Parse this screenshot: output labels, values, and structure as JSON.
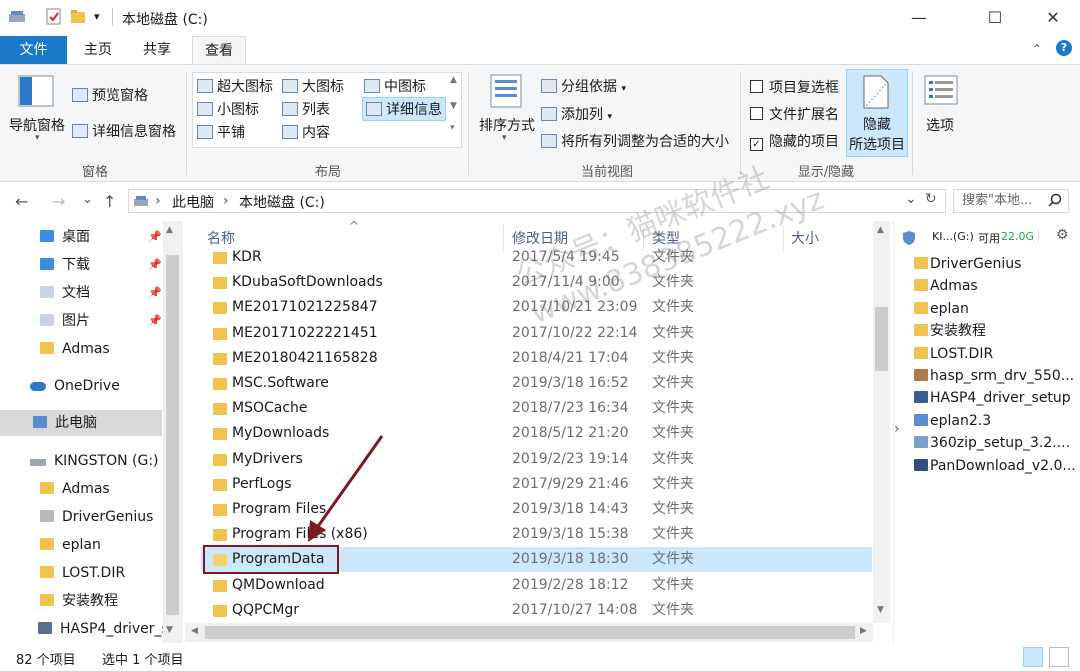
{
  "window": {
    "title": "本地磁盘 (C:)",
    "minimize": "—",
    "maximize": "☐",
    "close": "✕",
    "quick_access_dropdown": "▾"
  },
  "ribbon_tabs": {
    "file": "文件",
    "home": "主页",
    "share": "共享",
    "view": "查看"
  },
  "ribbon": {
    "panes": {
      "nav_pane": "导航窗格",
      "preview_pane": "预览窗格",
      "details_pane": "详细信息窗格",
      "group": "窗格"
    },
    "layout": {
      "xl_icons": "超大图标",
      "large_icons": "大图标",
      "medium_icons": "中图标",
      "small_icons": "小图标",
      "list": "列表",
      "details": "详细信息",
      "tiles": "平铺",
      "content": "内容",
      "group": "布局"
    },
    "current_view": {
      "sort_by": "排序方式",
      "group_by": "分组依据",
      "add_column": "添加列",
      "fit_columns": "将所有列调整为合适的大小",
      "group": "当前视图"
    },
    "show_hide": {
      "item_checkboxes": "项目复选框",
      "file_extensions": "文件扩展名",
      "hidden_items": "隐藏的项目",
      "hide_selected_line1": "隐藏",
      "hide_selected_line2": "所选项目",
      "group": "显示/隐藏"
    },
    "options": "选项"
  },
  "address": {
    "back": "←",
    "forward": "→",
    "recent": "⌄",
    "up": "↑",
    "crumb1": "此电脑",
    "sep": "›",
    "crumb2": "本地磁盘 (C:)",
    "dropdown": "⌄",
    "refresh": "↻",
    "search_placeholder": "搜索\"本地..."
  },
  "tree": [
    {
      "label": "桌面",
      "pin": "📌"
    },
    {
      "label": "下载",
      "pin": "📌"
    },
    {
      "label": "文档",
      "pin": "📌"
    },
    {
      "label": "图片",
      "pin": "📌"
    },
    {
      "label": "Admas",
      "pin": ""
    },
    {
      "label": "OneDrive",
      "pin": ""
    },
    {
      "label": "此电脑",
      "pin": ""
    },
    {
      "label": "KINGSTON (G:)",
      "pin": ""
    },
    {
      "label": "Admas",
      "pin": ""
    },
    {
      "label": "DriverGenius",
      "pin": ""
    },
    {
      "label": "eplan",
      "pin": ""
    },
    {
      "label": "LOST.DIR",
      "pin": ""
    },
    {
      "label": "安装教程",
      "pin": ""
    },
    {
      "label": "HASP4_driver_s",
      "pin": ""
    }
  ],
  "columns": {
    "name": "名称",
    "modified": "修改日期",
    "type": "类型",
    "size": "大小",
    "sort_indicator": "^"
  },
  "files": [
    {
      "name": "KDR",
      "date": "2017/5/4 19:45",
      "type": "文件夹"
    },
    {
      "name": "KDubaSoftDownloads",
      "date": "2017/11/4 9:00",
      "type": "文件夹"
    },
    {
      "name": "ME20171021225847",
      "date": "2017/10/21 23:09",
      "type": "文件夹"
    },
    {
      "name": "ME20171022221451",
      "date": "2017/10/22 22:14",
      "type": "文件夹"
    },
    {
      "name": "ME20180421165828",
      "date": "2018/4/21 17:04",
      "type": "文件夹"
    },
    {
      "name": "MSC.Software",
      "date": "2019/3/18 16:52",
      "type": "文件夹"
    },
    {
      "name": "MSOCache",
      "date": "2018/7/23 16:34",
      "type": "文件夹"
    },
    {
      "name": "MyDownloads",
      "date": "2018/5/12 21:20",
      "type": "文件夹"
    },
    {
      "name": "MyDrivers",
      "date": "2019/2/23 19:14",
      "type": "文件夹"
    },
    {
      "name": "PerfLogs",
      "date": "2017/9/29 21:46",
      "type": "文件夹"
    },
    {
      "name": "Program Files",
      "date": "2019/3/18 14:43",
      "type": "文件夹"
    },
    {
      "name": "Program Files (x86)",
      "date": "2019/3/18 15:38",
      "type": "文件夹"
    },
    {
      "name": "ProgramData",
      "date": "2019/3/18 18:30",
      "type": "文件夹"
    },
    {
      "name": "QMDownload",
      "date": "2019/2/28 18:12",
      "type": "文件夹"
    },
    {
      "name": "QQPCMgr",
      "date": "2017/10/27 14:08",
      "type": "文件夹"
    }
  ],
  "right_panel": {
    "drive_label": "KI...(G:)",
    "free_label": "可用",
    "free_value": "22.0G",
    "items": [
      "DriverGenius",
      "Admas",
      "eplan",
      "安装教程",
      "LOST.DIR",
      "hasp_srm_drv_550...",
      "HASP4_driver_setup",
      "eplan2.3",
      "360zip_setup_3.2....",
      "PanDownload_v2.0..."
    ]
  },
  "status": {
    "count": "82 个项目",
    "selected": "选中 1 个项目"
  },
  "watermark": {
    "line1": "公众号：猫咪软件社",
    "line2": "www.838385222.xyz"
  },
  "colors": {
    "accent": "#1979ca",
    "selection": "#cce8ff",
    "highlight_box": "#7b1a22",
    "folder": "#f0c24e"
  }
}
